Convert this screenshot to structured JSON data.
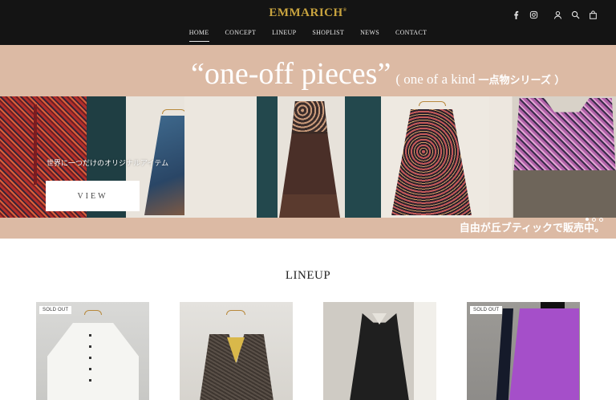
{
  "brand": {
    "name": "EMMARICH",
    "mark": "®",
    "accent": "#c9a43f"
  },
  "nav": [
    {
      "label": "HOME",
      "active": true
    },
    {
      "label": "CONCEPT"
    },
    {
      "label": "LINEUP"
    },
    {
      "label": "SHOPLIST"
    },
    {
      "label": "NEWS"
    },
    {
      "label": "CONTACT"
    }
  ],
  "header_icons": [
    "facebook-icon",
    "instagram-icon",
    "account-icon",
    "search-icon",
    "cart-icon"
  ],
  "hero": {
    "title_main": "“one-off pieces”",
    "title_sub": "( one of a kind",
    "title_jp": "一点物シリーズ ）",
    "caption": "世界に一つだけのオリジナルアイテム",
    "button_label": "VIEW",
    "footer_text": "自由が丘ブティックで販売中。",
    "slide_count": 3,
    "active_slide": 1,
    "background": "#dcbaa4"
  },
  "lineup": {
    "title": "LINEUP",
    "products": [
      {
        "badge": "SOLD OUT"
      },
      {
        "badge": ""
      },
      {
        "badge": ""
      },
      {
        "badge": "SOLD OUT"
      }
    ]
  }
}
